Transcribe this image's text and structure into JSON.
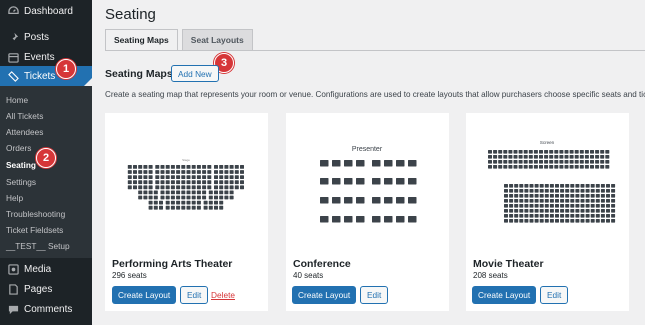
{
  "sidebar": {
    "top_items": [
      {
        "label": "Dashboard",
        "icon": "dashboard-icon"
      },
      {
        "label": "Posts",
        "icon": "pin-icon"
      },
      {
        "label": "Events",
        "icon": "calendar-icon"
      },
      {
        "label": "Tickets",
        "icon": "ticket-icon"
      }
    ],
    "submenu": [
      "Home",
      "All Tickets",
      "Attendees",
      "Orders",
      "Seating",
      "Settings",
      "Help",
      "Troubleshooting",
      "Ticket Fieldsets",
      "__TEST__ Setup"
    ],
    "bottom_items": [
      {
        "label": "Media",
        "icon": "media-icon"
      },
      {
        "label": "Pages",
        "icon": "page-icon"
      },
      {
        "label": "Comments",
        "icon": "comment-icon"
      }
    ]
  },
  "page": {
    "title": "Seating",
    "tabs": [
      "Seating Maps",
      "Seat Layouts"
    ],
    "section_title": "Seating Maps",
    "add_new_label": "Add New",
    "description": "Create a seating map that represents your room or venue. Configurations are used to create layouts that allow purchasers choose specific seats and ticket"
  },
  "cards": [
    {
      "title": "Performing Arts Theater",
      "seats": "296 seats",
      "stage_label": "Stage",
      "create_label": "Create Layout",
      "edit_label": "Edit",
      "delete_label": "Delete"
    },
    {
      "title": "Conference",
      "seats": "40 seats",
      "stage_label": "Presenter",
      "create_label": "Create Layout",
      "edit_label": "Edit"
    },
    {
      "title": "Movie Theater",
      "seats": "208 seats",
      "stage_label": "Screen",
      "create_label": "Create Layout",
      "edit_label": "Edit"
    }
  ],
  "badges": [
    "1",
    "2",
    "3"
  ],
  "colors": {
    "sidebar_bg": "#1d2327",
    "submenu_bg": "#2c3338",
    "accent": "#2271b1",
    "badge": "#d63638",
    "seat": "#3c434a"
  }
}
